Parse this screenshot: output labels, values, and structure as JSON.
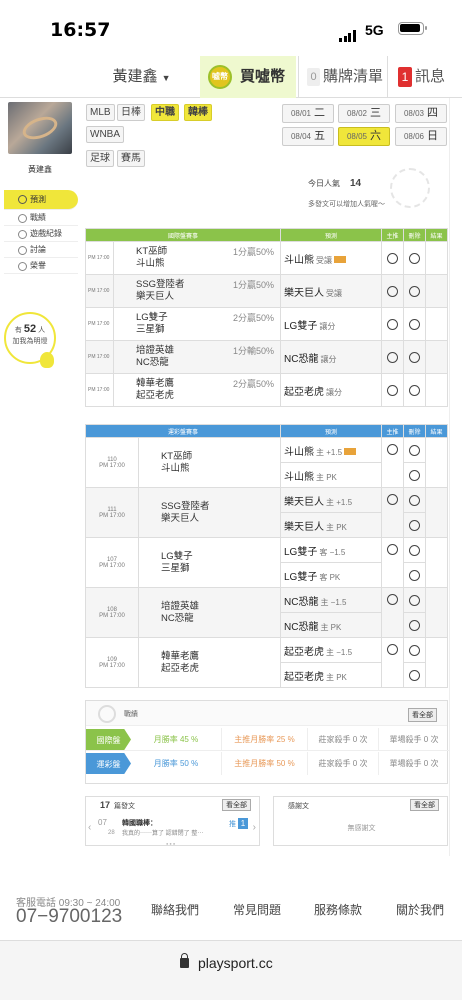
{
  "status_bar": {
    "time": "16:57",
    "network": "5G"
  },
  "topnav": {
    "user": "黃建鑫",
    "buy_icon_text": "噓幣",
    "buy_label": "買噓幣",
    "cart_count": "0",
    "cart_label": "購牌清單",
    "msg_count": "1",
    "msg_label": "訊息"
  },
  "sidebar": {
    "username": "黃建鑫",
    "items": [
      {
        "label": "預測"
      },
      {
        "label": "戰績"
      },
      {
        "label": "遊戲紀錄"
      },
      {
        "label": "討論"
      },
      {
        "label": "榮譽"
      }
    ],
    "bubble_prefix": "有",
    "bubble_count": "52",
    "bubble_unit": "人",
    "bubble_suffix": "加我為明燈"
  },
  "sports": [
    "MLB",
    "日棒",
    "中職",
    "韓棒",
    "WNBA",
    "足球",
    "賽馬"
  ],
  "active_sport": "韓棒",
  "dates": [
    {
      "md": "08/01",
      "wd": "二"
    },
    {
      "md": "08/02",
      "wd": "三"
    },
    {
      "md": "08/03",
      "wd": "四"
    },
    {
      "md": "08/04",
      "wd": "五"
    },
    {
      "md": "08/05",
      "wd": "六"
    },
    {
      "md": "08/06",
      "wd": "日"
    }
  ],
  "popularity": {
    "label": "今日人氣",
    "value": "14",
    "note": "多發文可以增加人氣喔～"
  },
  "intl_table": {
    "headers": [
      "國際盤賽事",
      "預測",
      "主推",
      "刪除",
      "結果"
    ],
    "rows": [
      {
        "time": "PM 17:00",
        "away": "KT巫師",
        "home": "斗山熊",
        "line": "1分贏50%",
        "pick": "斗山熊",
        "pick_sub": "受讓"
      },
      {
        "time": "PM 17:00",
        "away": "SSG登陸者",
        "home": "樂天巨人",
        "line": "1分贏50%",
        "pick": "樂天巨人",
        "pick_sub": "受讓"
      },
      {
        "time": "PM 17:00",
        "away": "LG雙子",
        "home": "三星獅",
        "line": "2分贏50%",
        "pick": "LG雙子",
        "pick_sub": "讓分"
      },
      {
        "time": "PM 17:00",
        "away": "培證英雄",
        "home": "NC恐龍",
        "line": "1分輸50%",
        "pick": "NC恐龍",
        "pick_sub": "讓分"
      },
      {
        "time": "PM 17:00",
        "away": "韓華老鷹",
        "home": "起亞老虎",
        "line": "2分贏50%",
        "pick": "起亞老虎",
        "pick_sub": "讓分"
      }
    ]
  },
  "lottery_table": {
    "headers": [
      "運彩盤賽事",
      "預測",
      "主推",
      "刪除",
      "結果"
    ],
    "rows": [
      {
        "num": "110",
        "time": "PM 17:00",
        "away": "KT巫師",
        "home": "斗山熊",
        "picks": [
          {
            "team": "斗山熊",
            "sub": "主 +1.5",
            "hot": true
          },
          {
            "team": "斗山熊",
            "sub": "主 PK",
            "hot": false
          }
        ]
      },
      {
        "num": "111",
        "time": "PM 17:00",
        "away": "SSG登陸者",
        "home": "樂天巨人",
        "picks": [
          {
            "team": "樂天巨人",
            "sub": "主 +1.5",
            "hot": false
          },
          {
            "team": "樂天巨人",
            "sub": "主 PK",
            "hot": false
          }
        ]
      },
      {
        "num": "107",
        "time": "PM 17:00",
        "away": "LG雙子",
        "home": "三星獅",
        "picks": [
          {
            "team": "LG雙子",
            "sub": "客 −1.5",
            "hot": false
          },
          {
            "team": "LG雙子",
            "sub": "客 PK",
            "hot": false
          }
        ]
      },
      {
        "num": "108",
        "time": "PM 17:00",
        "away": "培證英雄",
        "home": "NC恐龍",
        "picks": [
          {
            "team": "NC恐龍",
            "sub": "主 −1.5",
            "hot": false
          },
          {
            "team": "NC恐龍",
            "sub": "主 PK",
            "hot": false
          }
        ]
      },
      {
        "num": "109",
        "time": "PM 17:00",
        "away": "韓華老鷹",
        "home": "起亞老虎",
        "picks": [
          {
            "team": "起亞老虎",
            "sub": "主 −1.5",
            "hot": false
          },
          {
            "team": "起亞老虎",
            "sub": "主 PK",
            "hot": false
          }
        ]
      }
    ]
  },
  "record": {
    "title": "戰績",
    "view_all": "看全部",
    "rows": [
      {
        "label": "國際盤",
        "color": "#8bc34a",
        "cells": [
          "月勝率 45 %",
          "主推月勝率 25 %",
          "莊家殺手 0 次",
          "單場殺手 0 次"
        ]
      },
      {
        "label": "運彩盤",
        "color": "#4a98d8",
        "cells": [
          "月勝率 50 %",
          "主推月勝率 50 %",
          "莊家殺手 0 次",
          "單場殺手 0 次"
        ]
      }
    ]
  },
  "posts": {
    "count": "17",
    "label": "篇發文",
    "view_all": "看全部",
    "month": "07",
    "day": "28",
    "post_title": "韓國職棒：",
    "post_snippet": "我真的⋯⋯算了 認錯閉了 整⋯",
    "pin_label": "推",
    "pin_count": "1"
  },
  "thanks": {
    "title": "感謝文",
    "view_all": "看全部",
    "empty": "無感謝文"
  },
  "footer": {
    "phone_label": "客服電話 09:30 ~ 24:00",
    "phone": "07−9700123",
    "links": [
      "聯絡我們",
      "常見問題",
      "服務條款",
      "關於我們"
    ]
  },
  "url": "playsport.cc"
}
